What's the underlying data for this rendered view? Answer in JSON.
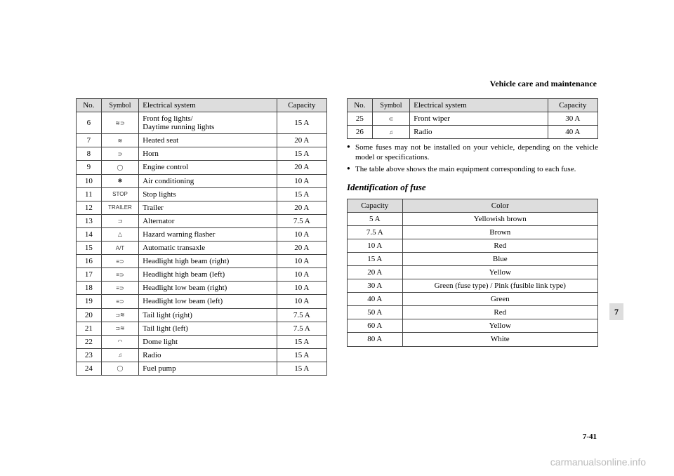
{
  "header": {
    "section_title": "Vehicle care and maintenance"
  },
  "table1": {
    "headers": {
      "no": "No.",
      "symbol": "Symbol",
      "system": "Electrical system",
      "capacity": "Capacity"
    },
    "rows": [
      {
        "no": "6",
        "sym": "≋⊃",
        "system": "Front fog lights/\nDaytime running lights",
        "cap": "15 A"
      },
      {
        "no": "7",
        "sym": "≋",
        "system": "Heated seat",
        "cap": "20 A"
      },
      {
        "no": "8",
        "sym": "⊃",
        "system": "Horn",
        "cap": "15 A"
      },
      {
        "no": "9",
        "sym": "◯",
        "system": "Engine control",
        "cap": "20 A"
      },
      {
        "no": "10",
        "sym": "✱",
        "system": "Air conditioning",
        "cap": "10 A"
      },
      {
        "no": "11",
        "sym": "STOP",
        "system": "Stop lights",
        "cap": "15 A"
      },
      {
        "no": "12",
        "sym": "TRAILER",
        "system": "Trailer",
        "cap": "20 A"
      },
      {
        "no": "13",
        "sym": "⊐",
        "system": "Alternator",
        "cap": "7.5 A"
      },
      {
        "no": "14",
        "sym": "△",
        "system": "Hazard warning flasher",
        "cap": "10 A"
      },
      {
        "no": "15",
        "sym": "A/T",
        "system": "Automatic transaxle",
        "cap": "20 A"
      },
      {
        "no": "16",
        "sym": "≡⊃",
        "system": "Headlight high beam (right)",
        "cap": "10 A"
      },
      {
        "no": "17",
        "sym": "≡⊃",
        "system": "Headlight high beam (left)",
        "cap": "10 A"
      },
      {
        "no": "18",
        "sym": "≡⊃",
        "system": "Headlight low beam (right)",
        "cap": "10 A"
      },
      {
        "no": "19",
        "sym": "≡⊃",
        "system": "Headlight low beam (left)",
        "cap": "10 A"
      },
      {
        "no": "20",
        "sym": "⊐≋",
        "system": "Tail light (right)",
        "cap": "7.5 A"
      },
      {
        "no": "21",
        "sym": "⊐≋",
        "system": "Tail light (left)",
        "cap": "7.5 A"
      },
      {
        "no": "22",
        "sym": "◠",
        "system": "Dome light",
        "cap": "15 A"
      },
      {
        "no": "23",
        "sym": "♫",
        "system": "Radio",
        "cap": "15 A"
      },
      {
        "no": "24",
        "sym": "◯",
        "system": "Fuel pump",
        "cap": "15 A"
      }
    ]
  },
  "table2": {
    "headers": {
      "no": "No.",
      "symbol": "Symbol",
      "system": "Electrical system",
      "capacity": "Capacity"
    },
    "rows": [
      {
        "no": "25",
        "sym": "⊂",
        "system": "Front wiper",
        "cap": "30 A"
      },
      {
        "no": "26",
        "sym": "♫",
        "system": "Radio",
        "cap": "40 A"
      }
    ]
  },
  "notes": [
    "Some fuses may not be installed on your vehicle, depending on the vehicle model or specifications.",
    "The table above shows the main equipment corresponding to each fuse."
  ],
  "subhead": "Identification of fuse",
  "fuse_table": {
    "headers": {
      "capacity": "Capacity",
      "color": "Color"
    },
    "rows": [
      {
        "cap": "5 A",
        "color": "Yellowish brown"
      },
      {
        "cap": "7.5 A",
        "color": "Brown"
      },
      {
        "cap": "10 A",
        "color": "Red"
      },
      {
        "cap": "15 A",
        "color": "Blue"
      },
      {
        "cap": "20 A",
        "color": "Yellow"
      },
      {
        "cap": "30 A",
        "color": "Green (fuse type) / Pink (fusible link type)"
      },
      {
        "cap": "40 A",
        "color": "Green"
      },
      {
        "cap": "50 A",
        "color": "Red"
      },
      {
        "cap": "60 A",
        "color": "Yellow"
      },
      {
        "cap": "80 A",
        "color": "White"
      }
    ]
  },
  "footer": {
    "page_number": "7-41",
    "section_tab": "7",
    "watermark": "carmanualsonline.info"
  }
}
